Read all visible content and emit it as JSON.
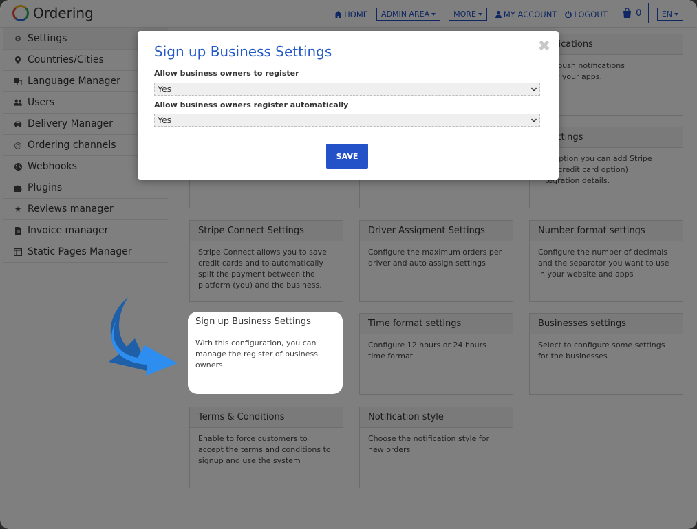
{
  "header": {
    "logo_text": "Ordering",
    "nav": {
      "home": "HOME",
      "admin_area": "ADMIN AREA",
      "more": "MORE",
      "my_account": "MY ACCOUNT",
      "logout": "LOGOUT",
      "cart_count": "0",
      "language": "EN"
    }
  },
  "sidebar": {
    "items": [
      {
        "label": "Settings",
        "icon": "gear-icon"
      },
      {
        "label": "Countries/Cities",
        "icon": "map-marker-icon"
      },
      {
        "label": "Language Manager",
        "icon": "language-icon"
      },
      {
        "label": "Users",
        "icon": "users-icon"
      },
      {
        "label": "Delivery Manager",
        "icon": "car-icon"
      },
      {
        "label": "Ordering channels",
        "icon": "at-icon"
      },
      {
        "label": "Webhooks",
        "icon": "globe-icon"
      },
      {
        "label": "Plugins",
        "icon": "puzzle-icon"
      },
      {
        "label": "Reviews manager",
        "icon": "star-icon"
      },
      {
        "label": "Invoice manager",
        "icon": "file-icon"
      },
      {
        "label": "Static Pages Manager",
        "icon": "window-icon"
      }
    ]
  },
  "cards": {
    "push": {
      "title": "notifications",
      "desc": "your push notifications\ngs for your apps."
    },
    "stripe": {
      "title": "e Settings",
      "desc": "this option you can add Stripe\nsave credit card option)\nintegration details."
    },
    "stripe_connect": {
      "title": "Stripe Connect Settings",
      "desc": "Stripe Connect allows you to save credit cards and to automatically split the payment between the platform (you) and the business."
    },
    "driver": {
      "title": "Driver Assigment Settings",
      "desc": "Configure the maximum orders per driver and auto assign settings"
    },
    "number": {
      "title": "Number format settings",
      "desc": "Configure the number of decimals and the separator you want to use in your website and apps"
    },
    "signup": {
      "title": "Sign up Business Settings",
      "desc": "With this configuration, you can manage the register of business owners"
    },
    "time": {
      "title": "Time format settings",
      "desc": "Configure 12 hours or 24 hours time format"
    },
    "businesses": {
      "title": "Businesses settings",
      "desc": "Select to configure some settings for the businesses"
    },
    "terms": {
      "title": "Terms & Conditions",
      "desc": "Enable to force customers to accept the terms and conditions to signup and use the system"
    },
    "notification_style": {
      "title": "Notification style",
      "desc": "Choose the notification style for new orders"
    }
  },
  "modal": {
    "title": "Sign up Business Settings",
    "field1_label": "Allow business owners to register",
    "field1_value": "Yes",
    "field2_label": "Allow business owners register automatically",
    "field2_value": "Yes",
    "save_label": "SAVE"
  },
  "colors": {
    "accent": "#2352c8",
    "title_blue": "#2459c8",
    "arrow_blue": "#2e8ef0"
  }
}
